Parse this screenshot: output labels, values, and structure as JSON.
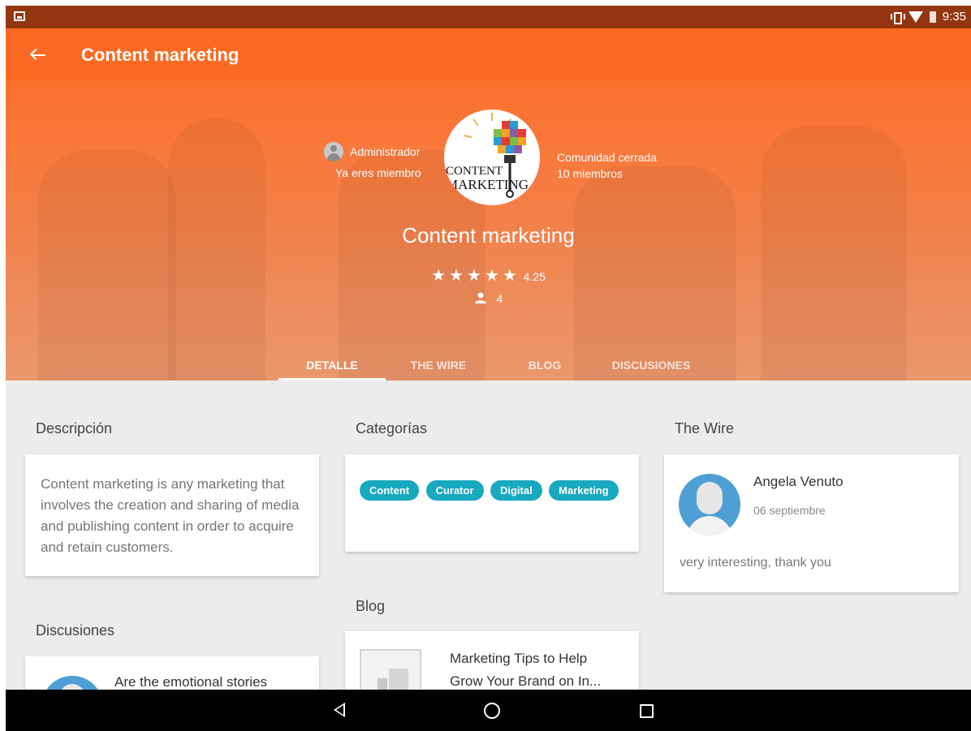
{
  "status_bar": {
    "time": "9:35"
  },
  "app_bar": {
    "title": "Content marketing"
  },
  "header": {
    "admin_role": "Administrador",
    "membership": "Ya eres miembro",
    "community_type": "Comunidad cerrada",
    "members_count": "10 miembros",
    "logo_text": [
      "CONTENT",
      "MARKETING"
    ],
    "title": "Content marketing",
    "stars": "★★★★★",
    "rating": "4.25",
    "followers": "4"
  },
  "tabs": [
    {
      "label": "DETALLE",
      "active": true
    },
    {
      "label": "THE WIRE",
      "active": false
    },
    {
      "label": "BLOG",
      "active": false
    },
    {
      "label": "DISCUSIONES",
      "active": false
    }
  ],
  "description": {
    "title": "Descripción",
    "text": "Content marketing is any marketing that involves the creation and sharing of media and publishing content in order to acquire and retain customers."
  },
  "categories": {
    "title": "Categorías",
    "chips": [
      "Content",
      "Curator",
      "Digital",
      "Marketing"
    ]
  },
  "wire": {
    "title": "The Wire",
    "author": "Angela Venuto",
    "date": "06 septiembre",
    "message": "very interesting, thank you"
  },
  "blog": {
    "title": "Blog",
    "post_title_line1": "Marketing Tips to Help",
    "post_title_line2": "Grow Your Brand on In..."
  },
  "discussions": {
    "title": "Discusiones",
    "item_title": "Are the emotional stories"
  },
  "colors": {
    "primary": "#fb6a22",
    "status_bar": "#93360f",
    "chip": "#17a9bf"
  }
}
